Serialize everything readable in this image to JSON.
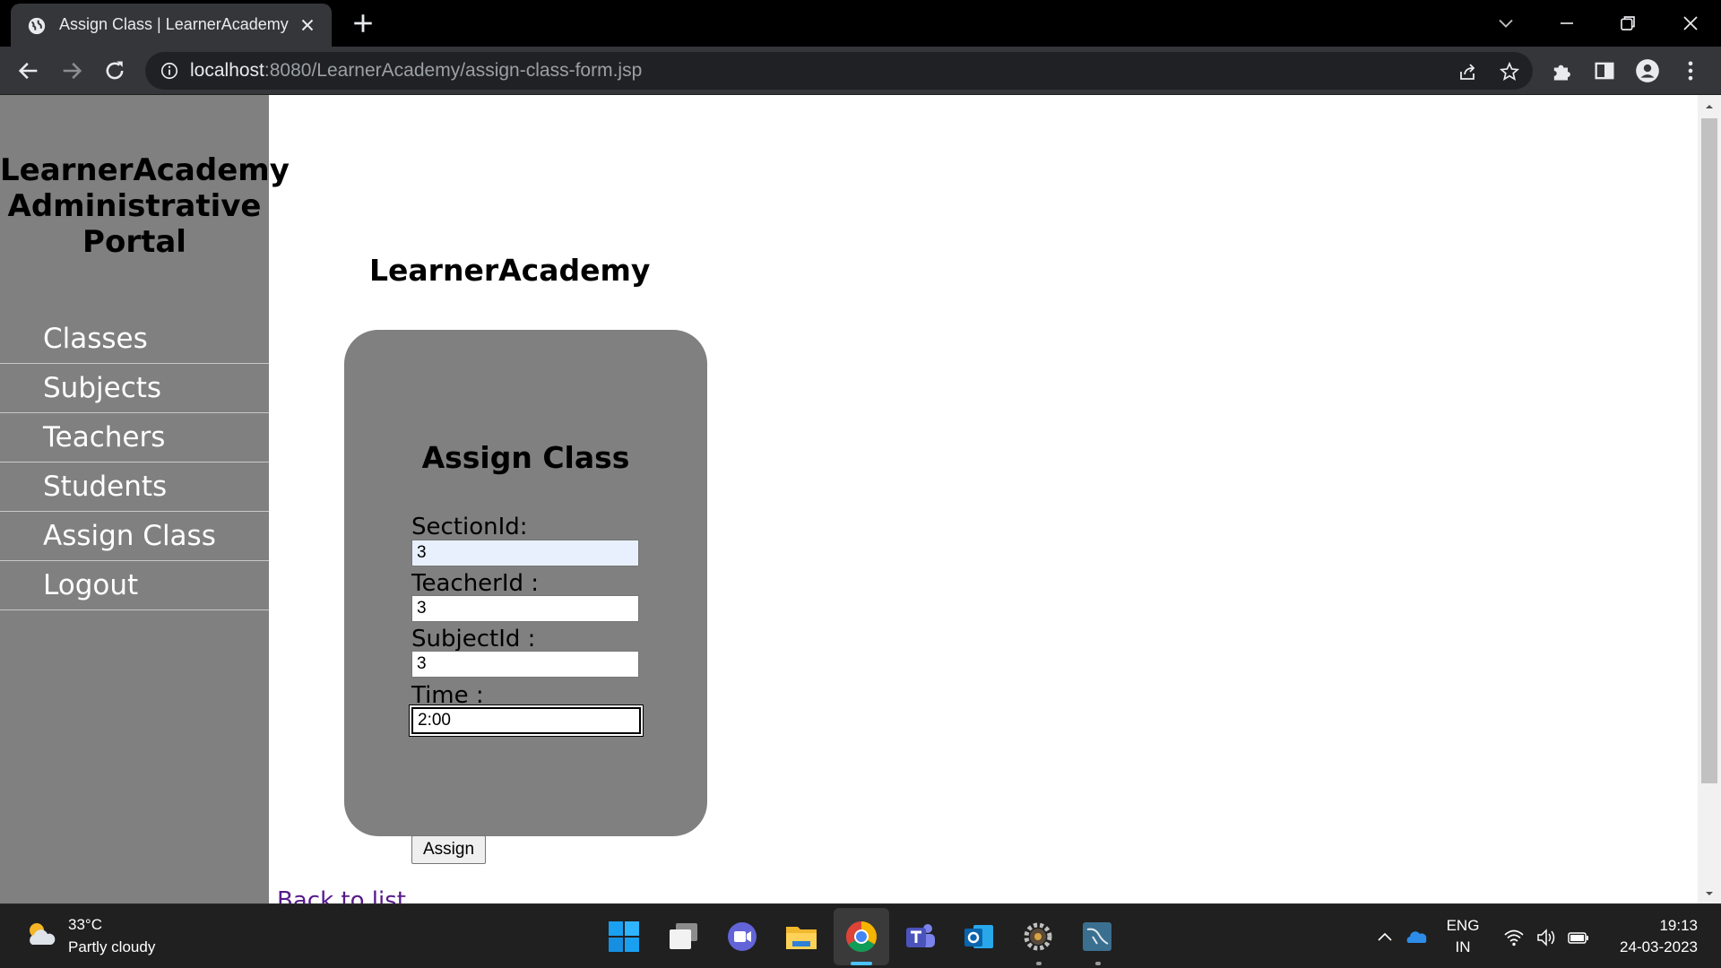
{
  "browser": {
    "tab_title": "Assign Class | LearnerAcademy",
    "url_host": "localhost",
    "url_path": ":8080/LearnerAcademy/assign-class-form.jsp"
  },
  "sidebar": {
    "title": "LearnerAcademy Administrative Portal",
    "items": [
      {
        "label": "Classes"
      },
      {
        "label": "Subjects"
      },
      {
        "label": "Teachers"
      },
      {
        "label": "Students"
      },
      {
        "label": "Assign Class"
      },
      {
        "label": "Logout"
      }
    ]
  },
  "main": {
    "brand": "LearnerAcademy",
    "form": {
      "heading": "Assign Class",
      "section_label": "SectionId:",
      "section_value": "3",
      "teacher_label": "TeacherId :",
      "teacher_value": "3",
      "subject_label": "SubjectId :",
      "subject_value": "3",
      "time_label": "Time :",
      "time_value": "2:00",
      "submit_label": "Assign"
    },
    "back_link": "Back to list"
  },
  "taskbar": {
    "weather_temp": "33°C",
    "weather_desc": "Partly cloudy",
    "lang_primary": "ENG",
    "lang_secondary": "IN",
    "time": "19:13",
    "date": "24-03-2023"
  },
  "colors": {
    "sidebar_bg": "#808080",
    "card_bg": "#808080",
    "link_visited": "#551a8b",
    "autofill_bg": "#e8f0fe"
  }
}
